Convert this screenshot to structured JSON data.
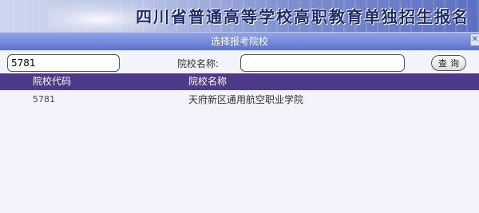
{
  "banner": {
    "title": "四川省普通高等学校高职教育单独招生报名"
  },
  "dialog": {
    "title": "选择报考院校"
  },
  "search": {
    "code_value": "5781",
    "name_label": "院校名称:",
    "name_value": "",
    "query_button": "查询"
  },
  "table": {
    "headers": [
      "院校代码",
      "院校名称"
    ],
    "rows": [
      {
        "code": "5781",
        "name": "天府新区通用航空职业学院"
      }
    ]
  },
  "colors": {
    "header_bg": "#4d3a88",
    "titlebar": "#5c72cf",
    "page_bg": "#f3f3fb"
  }
}
